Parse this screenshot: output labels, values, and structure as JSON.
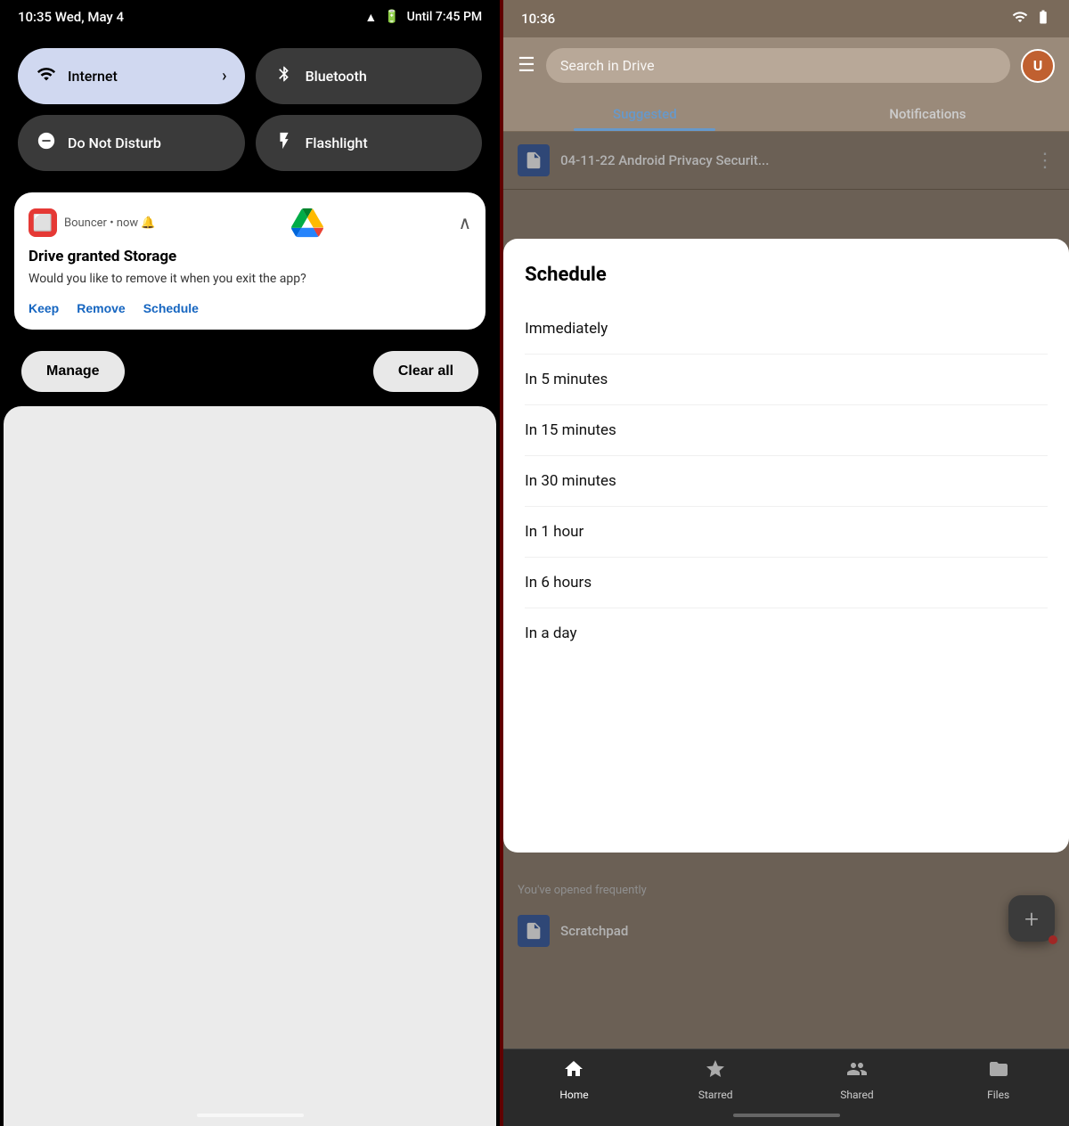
{
  "left": {
    "status": {
      "time": "10:35 Wed, May 4",
      "battery_text": "Until 7:45 PM"
    },
    "tiles": [
      {
        "id": "internet",
        "label": "Internet",
        "icon": "wifi",
        "active": true,
        "has_arrow": true
      },
      {
        "id": "bluetooth",
        "label": "Bluetooth",
        "icon": "bluetooth",
        "active": false
      },
      {
        "id": "dnd",
        "label": "Do Not Disturb",
        "icon": "minus-circle",
        "active": false
      },
      {
        "id": "flashlight",
        "label": "Flashlight",
        "icon": "flashlight",
        "active": false
      }
    ],
    "notification": {
      "app": "Bouncer",
      "time": "now",
      "title": "Drive granted Storage",
      "body": "Would you like to remove it when you exit the app?",
      "actions": [
        "Keep",
        "Remove",
        "Schedule"
      ]
    },
    "manage_label": "Manage",
    "clear_all_label": "Clear all"
  },
  "right": {
    "status": {
      "time": "10:36"
    },
    "search_placeholder": "Search in Drive",
    "tabs": [
      {
        "id": "suggested",
        "label": "Suggested",
        "active": true
      },
      {
        "id": "notifications",
        "label": "Notifications",
        "active": false
      }
    ],
    "file": {
      "name": "04-11-22 Android Privacy Securit..."
    },
    "schedule": {
      "title": "Schedule",
      "options": [
        "Immediately",
        "In 5 minutes",
        "In 15 minutes",
        "In 30 minutes",
        "In 1 hour",
        "In 6 hours",
        "In a day"
      ]
    },
    "frequently_label": "You've opened frequently",
    "scratchpad_label": "Scratchpad",
    "nav": [
      {
        "id": "home",
        "label": "Home",
        "active": true
      },
      {
        "id": "starred",
        "label": "Starred",
        "active": false
      },
      {
        "id": "shared",
        "label": "Shared",
        "active": false
      },
      {
        "id": "files",
        "label": "Files",
        "active": false
      }
    ]
  }
}
